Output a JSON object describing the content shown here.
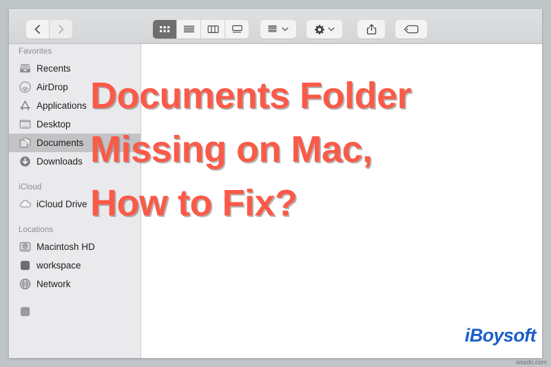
{
  "window": {
    "app": "Finder",
    "toolbar": {
      "nav": [
        {
          "name": "back-button",
          "icon": "chevron-left-icon",
          "enabled": true
        },
        {
          "name": "forward-button",
          "icon": "chevron-right-icon",
          "enabled": false
        }
      ],
      "view_modes": [
        {
          "name": "icon-view-button",
          "icon": "icon-view-icon",
          "selected": true
        },
        {
          "name": "list-view-button",
          "icon": "list-view-icon",
          "selected": false
        },
        {
          "name": "column-view-button",
          "icon": "column-view-icon",
          "selected": false
        },
        {
          "name": "gallery-view-button",
          "icon": "gallery-view-icon",
          "selected": false
        }
      ],
      "group_button": {
        "icon": "group-by-icon",
        "chevron": "chevron-down-icon"
      },
      "action_button": {
        "icon": "gear-icon",
        "chevron": "chevron-down-icon"
      },
      "share_button": {
        "icon": "share-icon"
      },
      "tag_button": {
        "icon": "tag-icon"
      }
    }
  },
  "sidebar": {
    "sections": [
      {
        "header": "Favorites",
        "items": [
          {
            "label": "Recents",
            "icon": "recents-icon",
            "selected": false
          },
          {
            "label": "AirDrop",
            "icon": "airdrop-icon",
            "selected": false
          },
          {
            "label": "Applications",
            "icon": "applications-icon",
            "selected": false
          },
          {
            "label": "Desktop",
            "icon": "desktop-icon",
            "selected": false
          },
          {
            "label": "Documents",
            "icon": "documents-icon",
            "selected": true
          },
          {
            "label": "Downloads",
            "icon": "downloads-icon",
            "selected": false
          }
        ]
      },
      {
        "header": "iCloud",
        "items": [
          {
            "label": "iCloud Drive",
            "icon": "icloud-icon",
            "selected": false
          }
        ]
      },
      {
        "header": "Locations",
        "items": [
          {
            "label": "Macintosh HD",
            "icon": "harddisk-icon",
            "selected": false
          },
          {
            "label": "workspace",
            "icon": "volume-icon",
            "selected": false
          },
          {
            "label": "Network",
            "icon": "network-globe-icon",
            "selected": false
          }
        ]
      }
    ]
  },
  "overlay": {
    "headline_lines": [
      "Documents Folder",
      "Missing on Mac,",
      "How to Fix?"
    ],
    "headline_color": "#fa5a47",
    "logo_text": "iBoysoft",
    "logo_color": "#1b5fc8",
    "watermark": "wsxdn.com"
  }
}
